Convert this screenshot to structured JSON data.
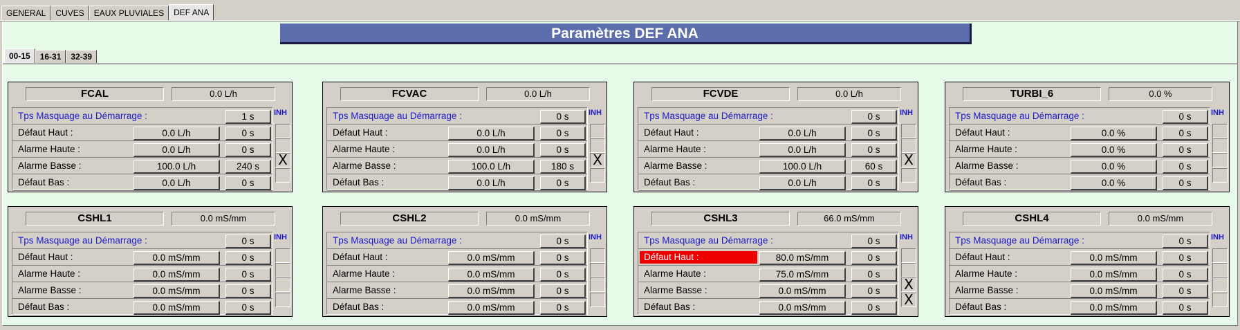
{
  "tabs": [
    "GENERAL",
    "CUVES",
    "EAUX PLUVIALES",
    "DEF ANA"
  ],
  "title": "Paramètres DEF ANA",
  "subtabs": [
    "00-15",
    "16-31",
    "32-39"
  ],
  "inh_label": "INH",
  "labels": {
    "tps": "Tps Masquage au Démarrage :",
    "defaut_haut": "Défaut Haut :",
    "alarme_haute": "Alarme Haute :",
    "alarme_basse": "Alarme Basse :",
    "defaut_bas": "Défaut Bas :"
  },
  "panels": [
    {
      "name": "FCAL",
      "value": "0.0 L/h",
      "tps": "1 s",
      "dh_v": "0.0 L/h",
      "dh_t": "0 s",
      "ah_v": "0.0 L/h",
      "ah_t": "0 s",
      "ab_v": "100.0 L/h",
      "ab_t": "240 s",
      "db_v": "0.0 L/h",
      "db_t": "0 s",
      "chk": [
        "",
        "",
        "X",
        ""
      ],
      "alarm_dh": false
    },
    {
      "name": "FCVAC",
      "value": "0.0 L/h",
      "tps": "0 s",
      "dh_v": "0.0 L/h",
      "dh_t": "0 s",
      "ah_v": "0.0 L/h",
      "ah_t": "0 s",
      "ab_v": "100.0 L/h",
      "ab_t": "180 s",
      "db_v": "0.0 L/h",
      "db_t": "0 s",
      "chk": [
        "",
        "",
        "X",
        ""
      ],
      "alarm_dh": false
    },
    {
      "name": "FCVDE",
      "value": "0.0 L/h",
      "tps": "0 s",
      "dh_v": "0.0 L/h",
      "dh_t": "0 s",
      "ah_v": "0.0 L/h",
      "ah_t": "0 s",
      "ab_v": "100.0 L/h",
      "ab_t": "60 s",
      "db_v": "0.0 L/h",
      "db_t": "0 s",
      "chk": [
        "",
        "",
        "X",
        ""
      ],
      "alarm_dh": false
    },
    {
      "name": "TURBI_6",
      "value": "0.0 %",
      "tps": "0 s",
      "dh_v": "0.0 %",
      "dh_t": "0 s",
      "ah_v": "0.0 %",
      "ah_t": "0 s",
      "ab_v": "0.0 %",
      "ab_t": "0 s",
      "db_v": "0.0 %",
      "db_t": "0 s",
      "chk": [
        "",
        "",
        "",
        ""
      ],
      "alarm_dh": false
    },
    {
      "name": "CSHL1",
      "value": "0.0 mS/mm",
      "tps": "0 s",
      "dh_v": "0.0 mS/mm",
      "dh_t": "0 s",
      "ah_v": "0.0 mS/mm",
      "ah_t": "0 s",
      "ab_v": "0.0 mS/mm",
      "ab_t": "0 s",
      "db_v": "0.0 mS/mm",
      "db_t": "0 s",
      "chk": [
        "",
        "",
        "",
        ""
      ],
      "alarm_dh": false
    },
    {
      "name": "CSHL2",
      "value": "0.0 mS/mm",
      "tps": "0 s",
      "dh_v": "0.0 mS/mm",
      "dh_t": "0 s",
      "ah_v": "0.0 mS/mm",
      "ah_t": "0 s",
      "ab_v": "0.0 mS/mm",
      "ab_t": "0 s",
      "db_v": "0.0 mS/mm",
      "db_t": "0 s",
      "chk": [
        "",
        "",
        "",
        ""
      ],
      "alarm_dh": false
    },
    {
      "name": "CSHL3",
      "value": "66.0 mS/mm",
      "tps": "0 s",
      "dh_v": "80.0 mS/mm",
      "dh_t": "0 s",
      "ah_v": "75.0 mS/mm",
      "ah_t": "0 s",
      "ab_v": "0.0 mS/mm",
      "ab_t": "0 s",
      "db_v": "0.0 mS/mm",
      "db_t": "0 s",
      "chk": [
        "",
        "",
        "X",
        "X"
      ],
      "alarm_dh": true
    },
    {
      "name": "CSHL4",
      "value": "0.0 mS/mm",
      "tps": "0 s",
      "dh_v": "0.0 mS/mm",
      "dh_t": "0 s",
      "ah_v": "0.0 mS/mm",
      "ah_t": "0 s",
      "ab_v": "0.0 mS/mm",
      "ab_t": "0 s",
      "db_v": "0.0 mS/mm",
      "db_t": "0 s",
      "chk": [
        "",
        "",
        "",
        ""
      ],
      "alarm_dh": false
    }
  ],
  "colors": {
    "title_bg": "#5b6eab",
    "content_bg": "#e8fae8",
    "alarm": "#ee0000",
    "inh": "#1a1ac8"
  }
}
